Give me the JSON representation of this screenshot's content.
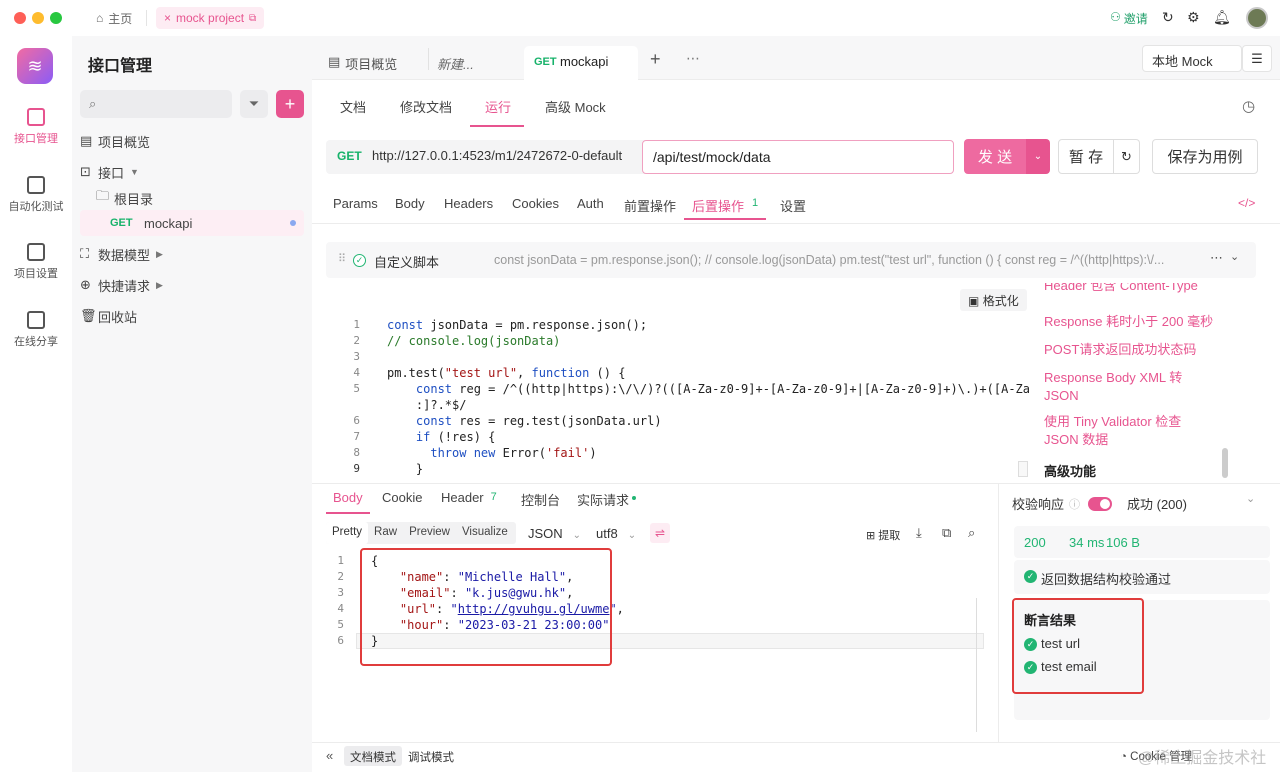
{
  "titlebar": {
    "home_label": "主页",
    "project_tab": "mock project",
    "invite_label": "邀请"
  },
  "rail": {
    "items": [
      {
        "label": "接口管理"
      },
      {
        "label": "自动化测试"
      },
      {
        "label": "项目设置"
      },
      {
        "label": "在线分享"
      }
    ]
  },
  "sidebar": {
    "title": "接口管理",
    "search_placeholder": "",
    "tree": {
      "overview": "项目概览",
      "interfaces": "接口",
      "root": "根目录",
      "api_method": "GET",
      "api_name": "mockapi",
      "models": "数据模型",
      "quick_requests": "快捷请求",
      "trash": "回收站"
    }
  },
  "tabs": {
    "items": [
      {
        "label": "项目概览"
      },
      {
        "label": "新建..."
      },
      {
        "method": "GET",
        "label": "mockapi"
      }
    ],
    "env_select": "本地 Mock"
  },
  "subtabs": [
    "文档",
    "修改文档",
    "运行",
    "高级 Mock"
  ],
  "request": {
    "method": "GET",
    "base_url": "http://127.0.0.1:4523/m1/2472672-0-default",
    "path": "/api/test/mock/data",
    "send_label": "发 送",
    "save_label": "暂 存",
    "save_case_label": "保存为用例"
  },
  "param_tabs": [
    {
      "label": "Params"
    },
    {
      "label": "Body"
    },
    {
      "label": "Headers"
    },
    {
      "label": "Cookies"
    },
    {
      "label": "Auth"
    },
    {
      "label": "前置操作"
    },
    {
      "label": "后置操作",
      "badge": "1"
    },
    {
      "label": "设置"
    }
  ],
  "script_panel": {
    "title": "自定义脚本",
    "preview": "const jsonData = pm.response.json(); // console.log(jsonData) pm.test(\"test url\", function () { const reg = /^((http|https):\\/...",
    "format_label": "格式化",
    "line_numbers": [
      "1",
      "2",
      "3",
      "4",
      "5",
      "",
      "6",
      "7",
      "8",
      "9"
    ],
    "snippets": [
      "Header 包含 Content-Type",
      "Response 耗时小于 200 毫秒",
      "POST请求返回成功状态码",
      "Response Body XML 转 JSON",
      "使用 Tiny Validator 检查 JSON 数据"
    ],
    "snippet_section": "高级功能"
  },
  "response": {
    "tabs": [
      {
        "label": "Body"
      },
      {
        "label": "Cookie"
      },
      {
        "label": "Header",
        "badge": "7"
      },
      {
        "label": "控制台"
      },
      {
        "label": "实际请求"
      }
    ],
    "view_modes": [
      "Pretty",
      "Raw",
      "Preview",
      "Visualize"
    ],
    "format": "JSON",
    "encoding": "utf8",
    "extract_label": "提取",
    "line_numbers": [
      "1",
      "2",
      "3",
      "4",
      "5",
      "6"
    ],
    "json": {
      "name": "Michelle Hall",
      "email": "k.jus@gwu.hk",
      "url": "http://gvuhgu.gl/uwme",
      "hour": "2023-03-21 23:00:00"
    }
  },
  "result": {
    "validate_label": "校验响应",
    "status_text": "成功 (200)",
    "status_code": "200",
    "time": "34 ms",
    "size": "106 B",
    "schema_pass": "返回数据结构校验通过",
    "assert_title": "断言结果",
    "assertions": [
      "test url",
      "test email"
    ]
  },
  "footer": {
    "doc_mode": "文档模式",
    "debug_mode": "调试模式",
    "cookie_mgr": "Cookie 管理",
    "watermark": "@稀土掘金技术社区"
  },
  "colors": {
    "accent": "#e7548f",
    "get": "#17b26a",
    "highlight_box": "#e03c3c",
    "success": "#22b573"
  }
}
